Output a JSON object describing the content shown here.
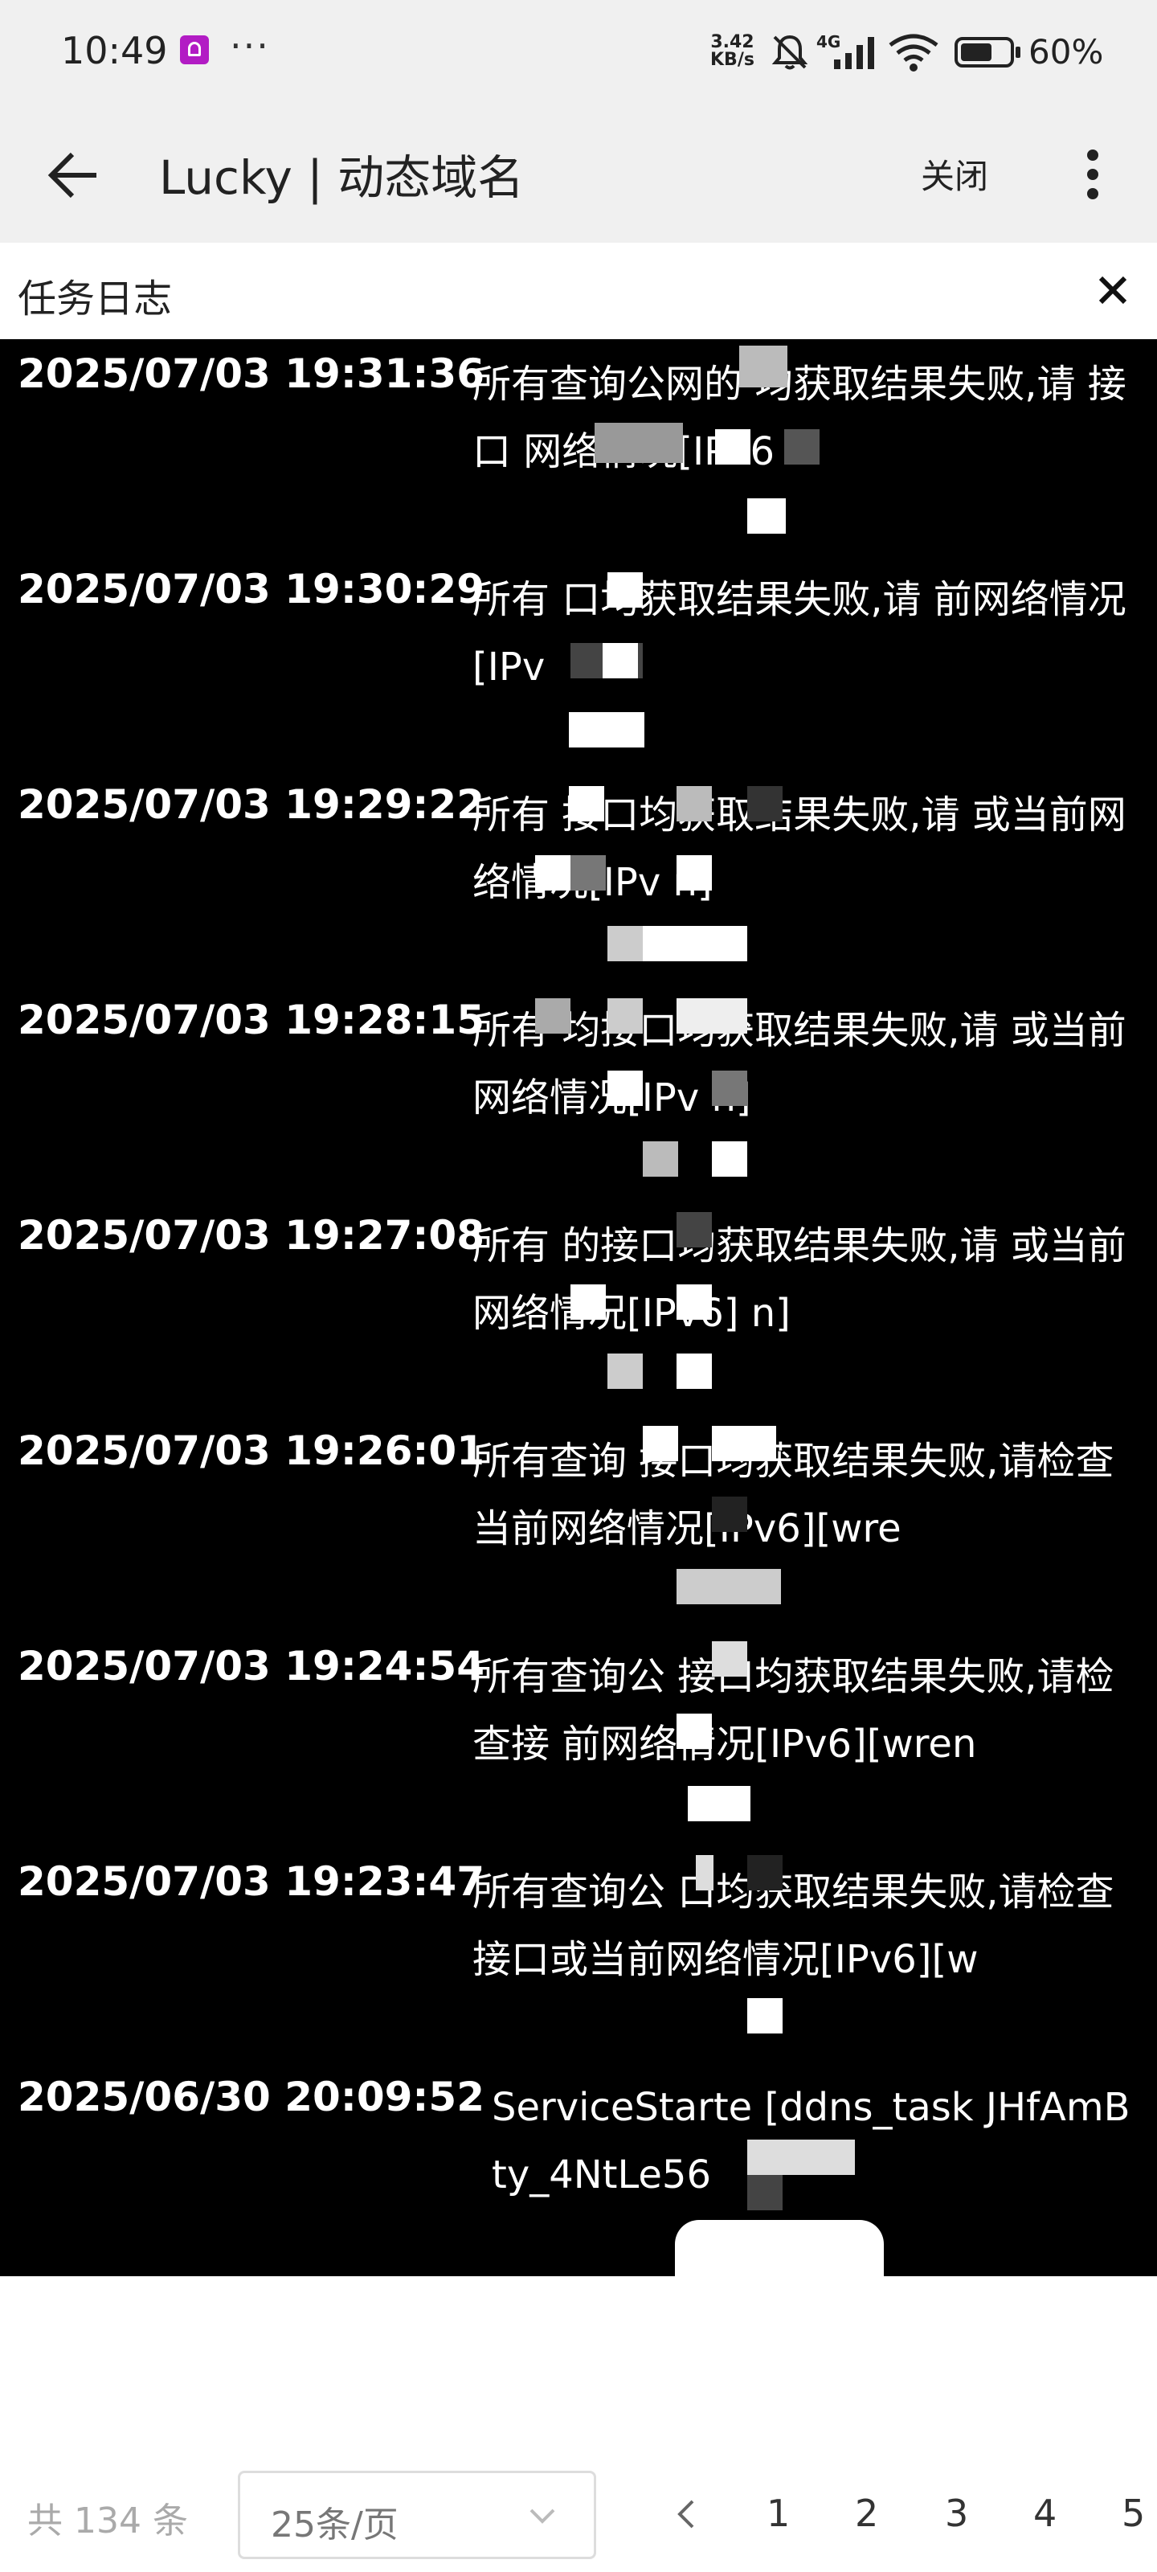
{
  "status_bar": {
    "time": "10:49",
    "more": "···",
    "net_speed_value": "3.42",
    "net_speed_unit": "KB/s",
    "network": "4G",
    "battery": "60%",
    "icons": [
      "notification-app-icon",
      "mute-icon",
      "signal-icon",
      "wifi-icon",
      "battery-icon"
    ]
  },
  "app_bar": {
    "title": "Lucky | 动态域名",
    "close_label": "关闭"
  },
  "panel": {
    "title": "任务日志"
  },
  "logs": [
    {
      "time": "2025/07/03 19:31:36",
      "message": "所有查询公网的 均获取结果失败,请 接口 网络情况[IPv6 n"
    },
    {
      "time": "2025/07/03 19:30:29",
      "message": "所有 口均获取结果失败,请 前网络情况[IPv"
    },
    {
      "time": "2025/07/03 19:29:22",
      "message": "所有 接口均获取结果失败,请 或当前网络情况[IPv n]"
    },
    {
      "time": "2025/07/03 19:28:15",
      "message": "所有 均接口均获取结果失败,请 或当前网络情况[IPv n]"
    },
    {
      "time": "2025/07/03 19:27:08",
      "message": "所有 的接口均获取结果失败,请 或当前网络情况[IPv6] n]"
    },
    {
      "time": "2025/07/03 19:26:01",
      "message": "所有查询 接口均获取结果失败,请检查 当前网络情况[IPv6][wre"
    },
    {
      "time": "2025/07/03 19:24:54",
      "message": "所有查询公 接口均获取结果失败,请检查接 前网络情况[IPv6][wren"
    },
    {
      "time": "2025/07/03 19:23:47",
      "message": "所有查询公 口均获取结果失败,请检查接口或当前网络情况[IPv6][w"
    },
    {
      "time": "2025/06/30 20:09:52",
      "message": "ServiceStarte [ddns_task JHfAmBty_4NtLe56"
    }
  ],
  "pagination": {
    "total": "共 134 条",
    "page_size": "25条/页",
    "prev": "<",
    "pages": [
      "1",
      "2",
      "3",
      "4",
      "5"
    ]
  },
  "colors": {
    "status_bar_bg": "#f0f0f0",
    "log_bg": "#000000",
    "log_text": "#ffffff",
    "notification_app": "#b21cc4"
  }
}
